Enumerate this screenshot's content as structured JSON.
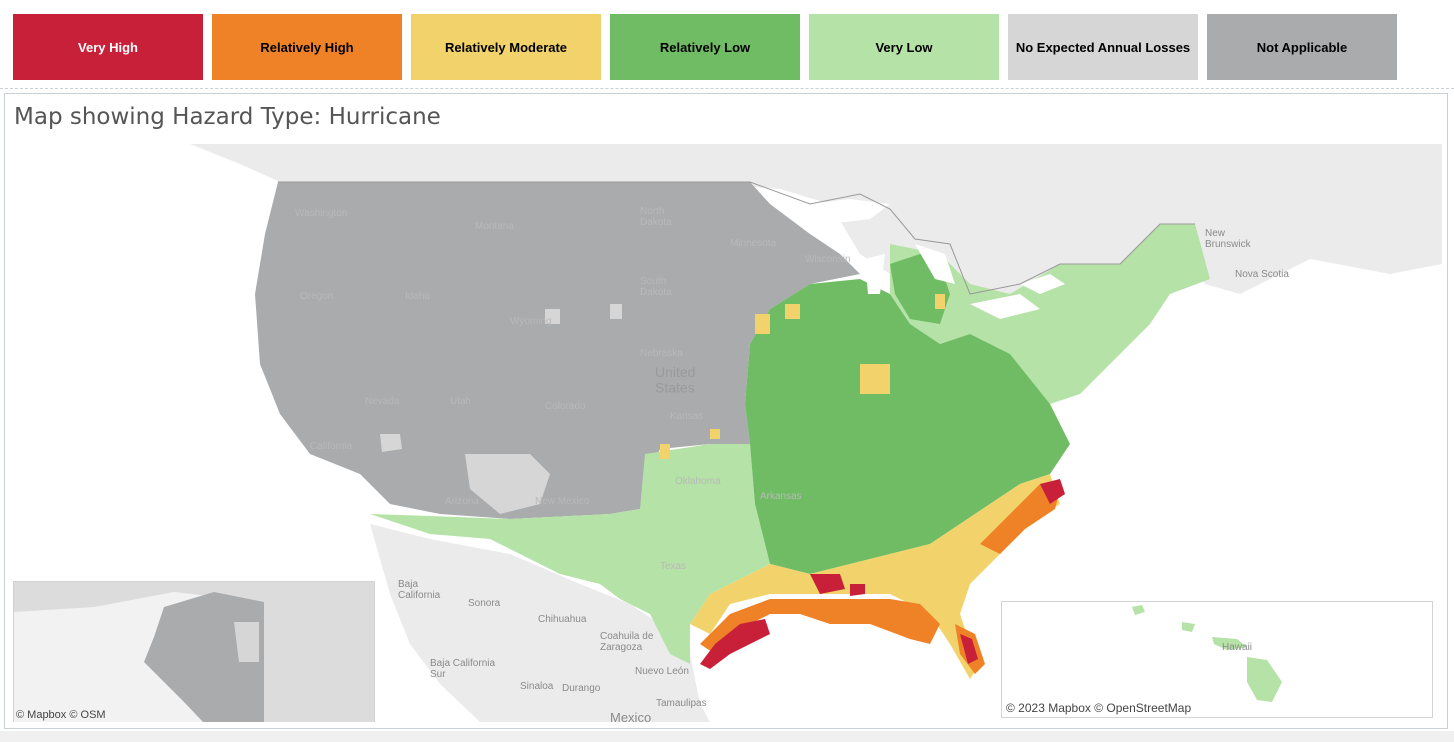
{
  "legend": {
    "items": [
      {
        "label": "Very High",
        "bg": "#c82038",
        "fg": "#ffffff"
      },
      {
        "label": "Relatively High",
        "bg": "#ef8227",
        "fg": "#222222"
      },
      {
        "label": "Relatively Moderate",
        "bg": "#f2d36b",
        "fg": "#222222"
      },
      {
        "label": "Relatively Low",
        "bg": "#70bc64",
        "fg": "#222222"
      },
      {
        "label": "Very Low",
        "bg": "#b5e2a6",
        "fg": "#222222"
      },
      {
        "label": "No Expected Annual Losses",
        "bg": "#d6d6d6",
        "fg": "#222222"
      },
      {
        "label": "Not Applicable",
        "bg": "#a9abad",
        "fg": "#222222"
      }
    ]
  },
  "panel": {
    "title": "Map showing Hazard Type:  Hurricane"
  },
  "map": {
    "labels": {
      "washington": "Washington",
      "oregon": "Oregon",
      "california": "California",
      "idaho": "Idaho",
      "nevada": "Nevada",
      "utah": "Utah",
      "arizona": "Arizona",
      "montana": "Montana",
      "wyoming": "Wyoming",
      "colorado": "Colorado",
      "new_mexico": "New Mexico",
      "north_dakota": "North\nDakota",
      "south_dakota": "South\nDakota",
      "nebraska": "Nebraska",
      "kansas": "Kansas",
      "oklahoma": "Oklahoma",
      "texas": "Texas",
      "minnesota": "Minnesota",
      "wisconsin": "Wisconsin",
      "arkansas": "Arkansas",
      "united_states": "United\nStates",
      "new_brunswick": "New\nBrunswick",
      "nova_scotia": "Nova Scotia",
      "baja_california": "Baja\nCalifornia",
      "sonora": "Sonora",
      "chihuahua": "Chihuahua",
      "coahuila": "Coahuila de\nZaragoza",
      "baja_california_sur": "Baja California\nSur",
      "nuevo_leon": "Nuevo León",
      "sinaloa": "Sinaloa",
      "durango": "Durango",
      "tamaulipas": "Tamaulipas",
      "mexico": "Mexico",
      "hawaii": "Hawaii"
    },
    "attribution_left": "© Mapbox © OSM",
    "attribution_right": "© 2023 Mapbox © OpenStreetMap"
  },
  "colors": {
    "very_high": "#c82038",
    "relatively_high": "#ef8227",
    "relatively_moderate": "#f2d36b",
    "relatively_low": "#70bc64",
    "very_low": "#b5e2a6",
    "no_losses": "#d6d6d6",
    "not_applicable": "#a9abad",
    "basemap": "#ebebeb",
    "water": "#ffffff"
  }
}
